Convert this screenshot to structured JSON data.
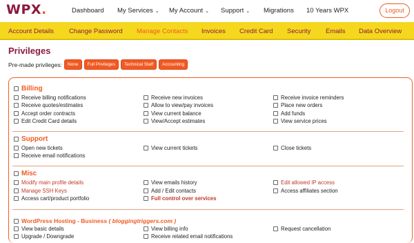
{
  "header": {
    "logo_text": "WPX",
    "nav": [
      {
        "label": "Dashboard",
        "caret": false
      },
      {
        "label": "My Services",
        "caret": true
      },
      {
        "label": "My Account",
        "caret": true
      },
      {
        "label": "Support",
        "caret": true
      },
      {
        "label": "Migrations",
        "caret": false
      },
      {
        "label": "10 Years WPX",
        "caret": false
      }
    ],
    "logout_label": "Logout"
  },
  "tabs": [
    {
      "label": "Account Details",
      "active": false
    },
    {
      "label": "Change Password",
      "active": false
    },
    {
      "label": "Manage Contacts",
      "active": true
    },
    {
      "label": "Invoices",
      "active": false
    },
    {
      "label": "Credit Card",
      "active": false
    },
    {
      "label": "Security",
      "active": false
    },
    {
      "label": "Emails",
      "active": false
    },
    {
      "label": "Data Overview",
      "active": false
    }
  ],
  "page": {
    "title": "Privileges",
    "premade_label": "Pre-made privileges:",
    "premade_buttons": [
      "None",
      "Full Privileges",
      "Technical Staff",
      "Accounting"
    ]
  },
  "sections": {
    "billing": {
      "title": "Billing",
      "items": [
        "Receive billing notifications",
        "Receive new invoices",
        "Receive invoice reminders",
        "Receive quotes/estimates",
        "Allow to view/pay invoices",
        "Place new orders",
        "Accept order contracts",
        "View current balance",
        "Add funds",
        "Edit Credit Card details",
        "View/Accept estimates",
        "View service prices"
      ]
    },
    "support": {
      "title": "Support",
      "items": [
        "Open new tickets",
        "View current tickets",
        "Close tickets",
        "Receive email notifications"
      ]
    },
    "misc": {
      "title": "Misc",
      "items": [
        "Modify main profile details",
        "View emails history",
        "Edit allowed IP access",
        "Manage SSH Keys",
        "Add / Edit contacts",
        "Access affiliates section",
        "Access cart/product portfolio",
        "Full control over services"
      ]
    },
    "hosting": {
      "title": "WordPress Hosting - Business",
      "domain": "( bloggingtriggers.com )",
      "items": [
        "View basic details",
        "View billing info",
        "Request cancellation",
        "Upgrade / Downgrade",
        "Receive related email notifications"
      ]
    }
  },
  "colors": {
    "brand": "#8b1a3f",
    "accent": "#f15a22",
    "tabbar": "#f5d81e"
  }
}
